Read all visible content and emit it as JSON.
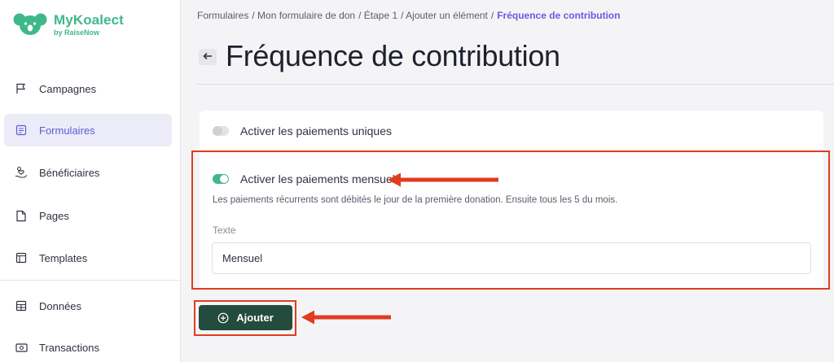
{
  "brand": {
    "name": "MyKoalect",
    "by": "by RaiseNow",
    "color": "#3fb889"
  },
  "sidebar": {
    "items": [
      {
        "label": "Campagnes",
        "icon": "flag-icon",
        "active": false
      },
      {
        "label": "Formulaires",
        "icon": "form-icon",
        "active": true
      },
      {
        "label": "Bénéficiaires",
        "icon": "hand-heart-icon",
        "active": false
      },
      {
        "label": "Pages",
        "icon": "page-icon",
        "active": false
      },
      {
        "label": "Templates",
        "icon": "template-icon",
        "active": false
      },
      {
        "label": "Données",
        "icon": "table-icon",
        "active": false
      },
      {
        "label": "Transactions",
        "icon": "cash-icon",
        "active": false
      }
    ]
  },
  "breadcrumb": {
    "items": [
      "Formulaires",
      "/ Mon formulaire de don",
      "/ Étape 1",
      "/ Ajouter un élément",
      "/"
    ],
    "current": "Fréquence de contribution"
  },
  "page": {
    "title": "Fréquence de contribution"
  },
  "settings": {
    "one_time": {
      "label": "Activer les paiements uniques",
      "enabled": false
    },
    "monthly": {
      "label": "Activer les paiements mensuels",
      "enabled": true,
      "helper": "Les paiements récurrents sont débités le jour de la première donation. Ensuite tous les 5 du mois."
    },
    "text_field": {
      "label": "Texte",
      "value": "Mensuel"
    }
  },
  "actions": {
    "add_label": "Ajouter"
  },
  "colors": {
    "accent": "#5b5bd6",
    "button": "#234c3e",
    "annotation": "#e03c1f",
    "toggle_on": "#3fb889"
  }
}
